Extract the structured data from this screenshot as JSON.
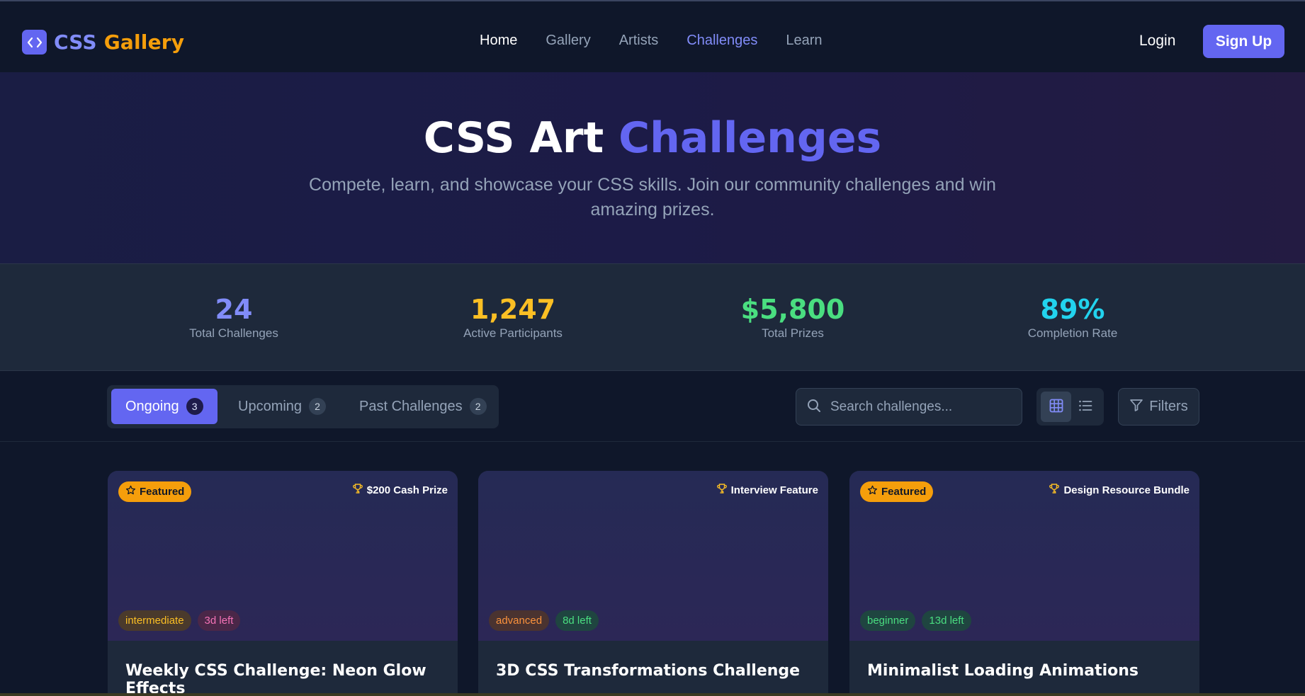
{
  "header": {
    "logo": {
      "icon": "code-brackets-icon",
      "text_part1": "CSS",
      "text_part2": "Gallery"
    },
    "nav": [
      {
        "label": "Home",
        "state": "current"
      },
      {
        "label": "Gallery",
        "state": "default"
      },
      {
        "label": "Artists",
        "state": "default"
      },
      {
        "label": "Challenges",
        "state": "active"
      },
      {
        "label": "Learn",
        "state": "default"
      }
    ],
    "login_label": "Login",
    "signup_label": "Sign Up"
  },
  "hero": {
    "title_main": "CSS Art",
    "title_accent": "Challenges",
    "subtitle": "Compete, learn, and showcase your CSS skills. Join our community challenges and win amazing prizes."
  },
  "stats": [
    {
      "value": "24",
      "label": "Total Challenges",
      "color": "#818cf8"
    },
    {
      "value": "1,247",
      "label": "Active Participants",
      "color": "#fbbf24"
    },
    {
      "value": "$5,800",
      "label": "Total Prizes",
      "color": "#4ade80"
    },
    {
      "value": "89%",
      "label": "Completion Rate",
      "color": "#22d3ee"
    }
  ],
  "toolbar": {
    "tabs": [
      {
        "label": "Ongoing",
        "count": "3",
        "active": true
      },
      {
        "label": "Upcoming",
        "count": "2",
        "active": false
      },
      {
        "label": "Past Challenges",
        "count": "2",
        "active": false
      }
    ],
    "search": {
      "placeholder": "Search challenges...",
      "value": "",
      "icon": "search-icon"
    },
    "view_toggle": {
      "selected": "grid",
      "options": [
        "grid-view-icon",
        "list-view-icon"
      ]
    },
    "filters_label": "Filters"
  },
  "cards": [
    {
      "featured": true,
      "featured_label": "Featured",
      "prize": "$200 Cash Prize",
      "difficulty": "intermediate",
      "time_left": "3d left",
      "title": "Weekly CSS Challenge: Neon Glow Effects"
    },
    {
      "featured": false,
      "featured_label": "",
      "prize": "Interview Feature",
      "difficulty": "advanced",
      "time_left": "8d left",
      "title": "3D CSS Transformations Challenge"
    },
    {
      "featured": true,
      "featured_label": "Featured",
      "prize": "Design Resource Bundle",
      "difficulty": "beginner",
      "time_left": "13d left",
      "title": "Minimalist Loading Animations"
    }
  ],
  "colors": {
    "accent": "#6366f1",
    "brand_orange": "#f59e0b",
    "background": "#0f172a",
    "surface": "#1e293b",
    "tag_intermediate": "#fbbf24",
    "tag_advanced": "#fb923c",
    "tag_beginner": "#4ade80",
    "tag_time_urgent": "#f472b6",
    "tag_time_ok": "#4ade80"
  }
}
